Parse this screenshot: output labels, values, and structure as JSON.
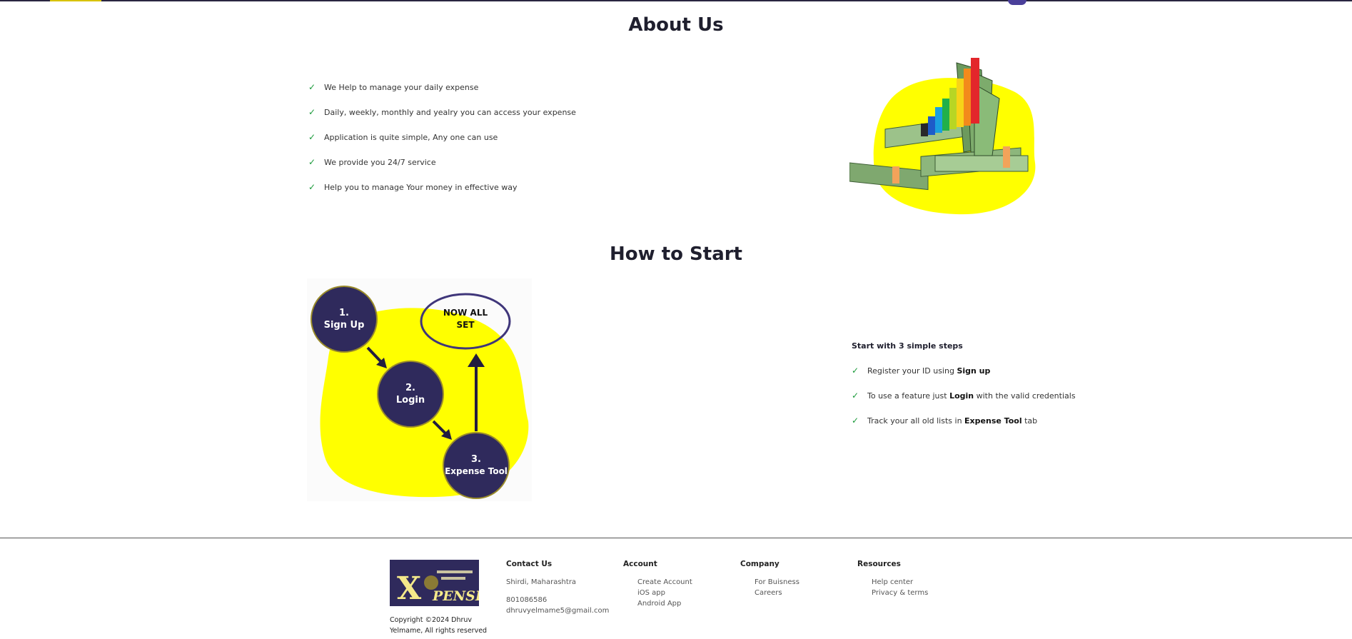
{
  "about": {
    "title": "About Us",
    "items": [
      " We Help to manage your daily expense",
      "Daily, weekly, monthly and yealry you can access your expense",
      "Application is quite simple, Any one can use",
      "We provide you 24/7 service",
      "Help you to manage Your money in effective way"
    ]
  },
  "how": {
    "title": "How to Start",
    "steps_title": "Start with 3 simple steps",
    "steps": [
      {
        "pre": "Register your ID using ",
        "strong": "Sign up",
        "post": ""
      },
      {
        "pre": "To use a feature just ",
        "strong": "Login",
        "post": " with the valid credentials"
      },
      {
        "pre": "Track your all old lists in ",
        "strong": "Expense Tool",
        "post": " tab"
      }
    ],
    "diagram": {
      "step1": [
        "1.",
        "Sign Up"
      ],
      "step2": [
        "2.",
        "Login"
      ],
      "step3": [
        "3.",
        "Expense Tool"
      ],
      "done": [
        "NOW ALL",
        "SET"
      ]
    }
  },
  "footer": {
    "logo_text": "X",
    "logo_word": "PENSE",
    "copyright": "Copyright ©2024 Dhruv Yelmame, All rights reserved",
    "contact": {
      "heading": "Contact Us",
      "location": "Shirdi, Maharashtra",
      "phone": "801086586",
      "email": "dhruvyelmame5@gmail.com"
    },
    "account": {
      "heading": "Account",
      "items": [
        "Create Account",
        "iOS app",
        "Android App"
      ]
    },
    "company": {
      "heading": "Company",
      "items": [
        "For Buisness",
        "Careers"
      ]
    },
    "resources": {
      "heading": "Resources",
      "items": [
        "Help center",
        "Privacy & terms"
      ]
    }
  },
  "colors": {
    "brand": "#2f2a5c",
    "accent": "#ffff00",
    "check": "#1a9a3a"
  }
}
